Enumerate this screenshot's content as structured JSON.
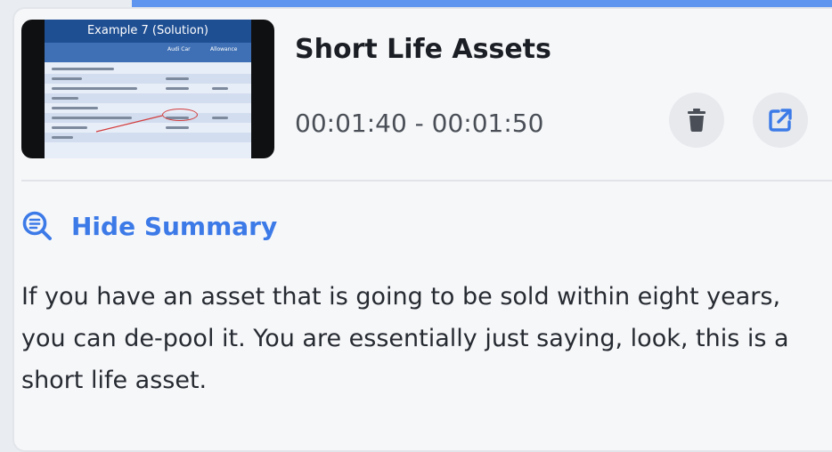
{
  "clip": {
    "title": "Short Life Assets",
    "time_range": "00:01:40 - 00:01:50",
    "thumbnail": {
      "slide_title": "Example 7 (Solution)",
      "col1": "Audi Car",
      "col2": "Allowance"
    }
  },
  "actions": {
    "delete_icon": "trash-icon",
    "open_icon": "external-link-icon"
  },
  "summary": {
    "toggle_icon": "zoom-summary-icon",
    "toggle_label": "Hide Summary",
    "text": "If you have an asset that is going to be sold within eight years, you can de-pool it. You are essentially just saying, look, this is a short life asset."
  },
  "colors": {
    "accent": "#3c7ae8",
    "topbar": "#5f95ee",
    "card_bg": "#f6f7f9",
    "title": "#1b1e24",
    "body_text": "#262a31"
  }
}
